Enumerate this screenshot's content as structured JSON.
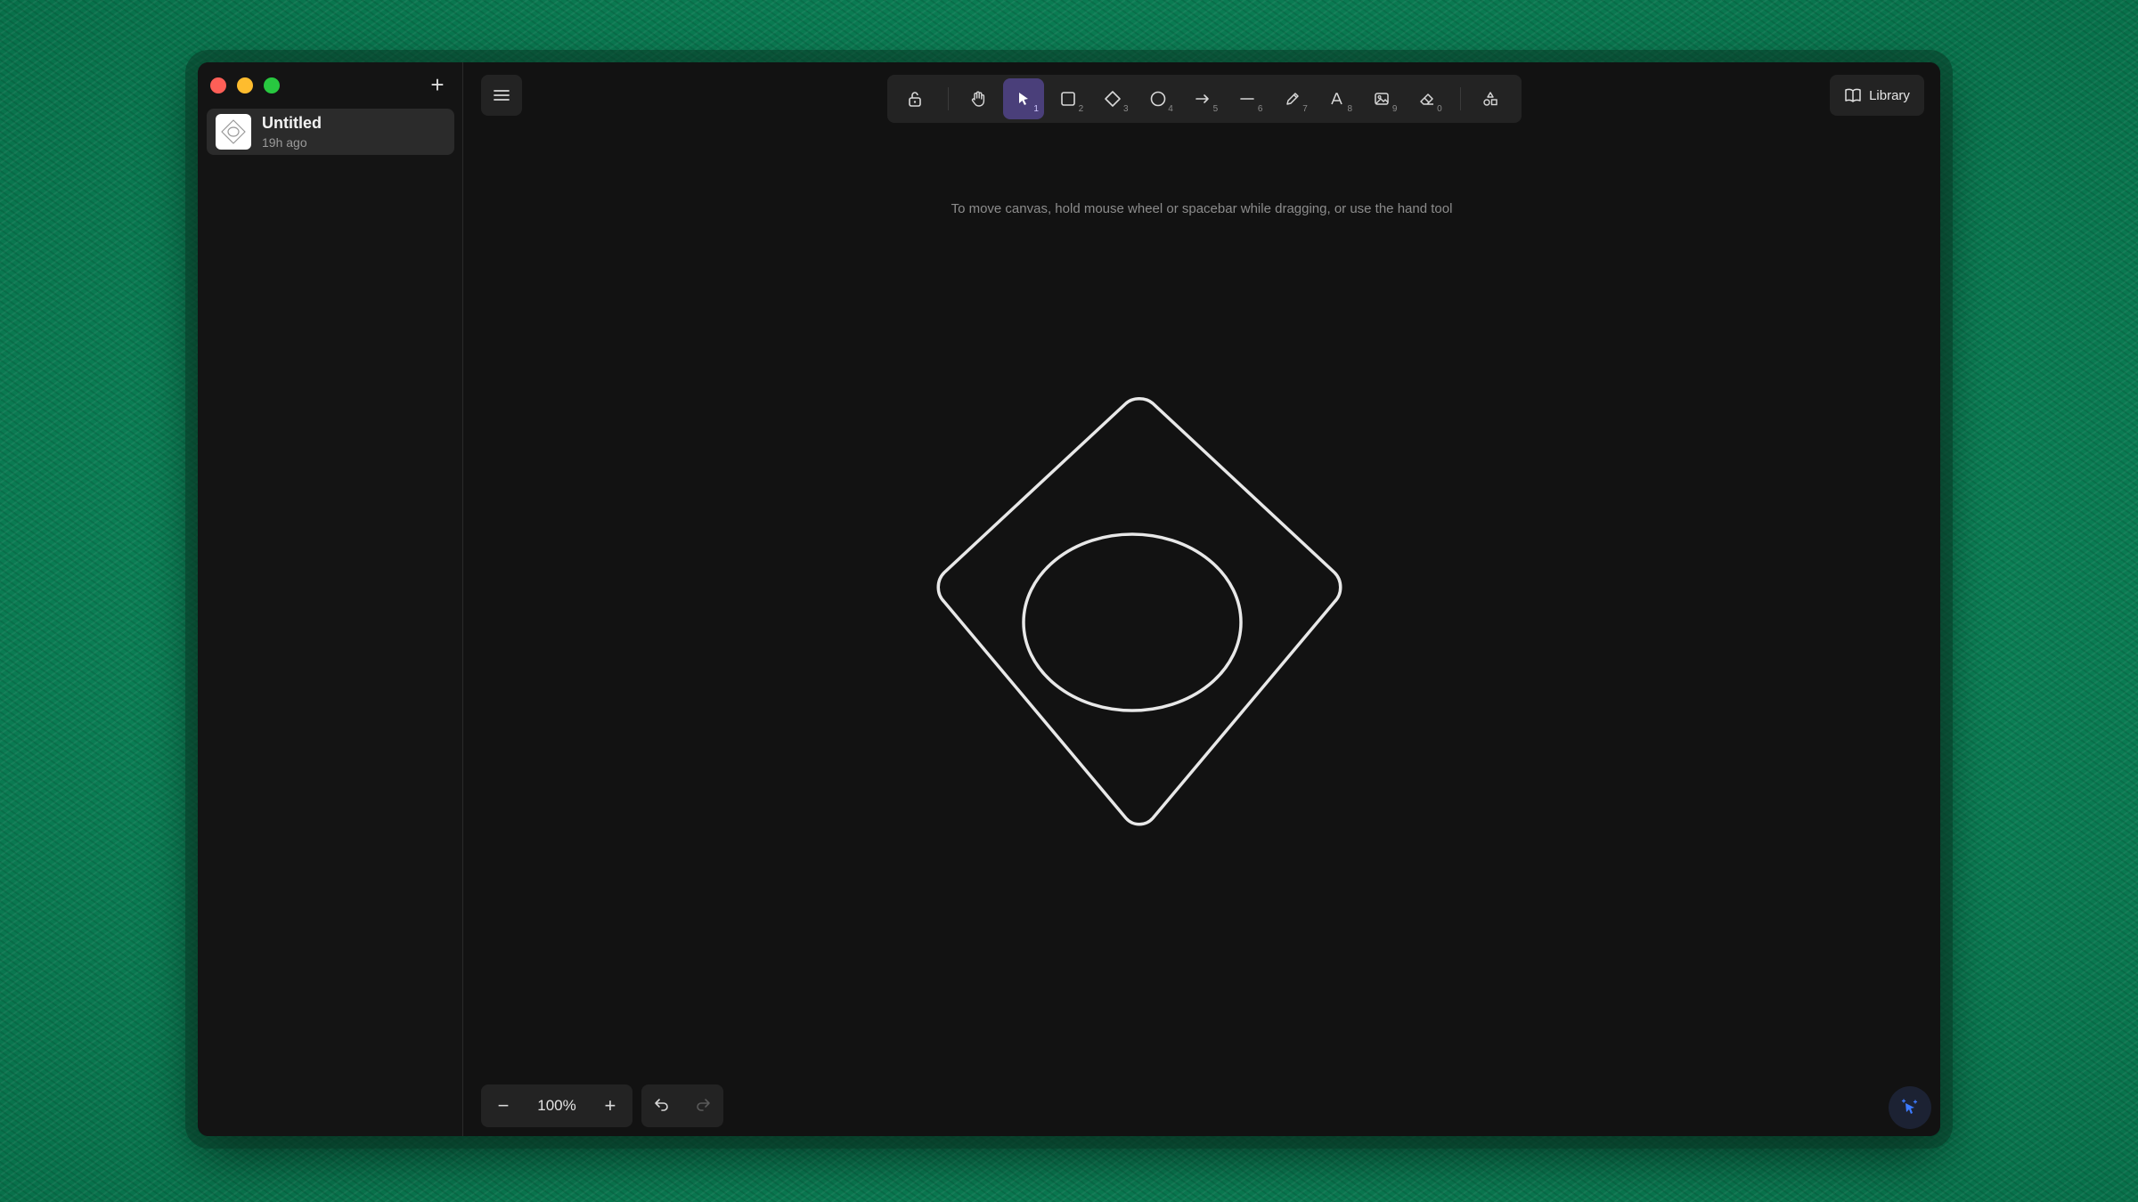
{
  "sidebar": {
    "new_button_label": "+",
    "files": [
      {
        "name": "Untitled",
        "time": "19h ago"
      }
    ]
  },
  "toolbar": {
    "tools": [
      {
        "name": "lock",
        "icon": "lock-icon",
        "key": ""
      },
      {
        "name": "hand",
        "icon": "hand-icon",
        "key": ""
      },
      {
        "name": "selection",
        "icon": "pointer-icon",
        "key": "1",
        "active": true
      },
      {
        "name": "rectangle",
        "icon": "rectangle-icon",
        "key": "2"
      },
      {
        "name": "diamond",
        "icon": "diamond-icon",
        "key": "3"
      },
      {
        "name": "ellipse",
        "icon": "ellipse-icon",
        "key": "4"
      },
      {
        "name": "arrow",
        "icon": "arrow-icon",
        "key": "5"
      },
      {
        "name": "line",
        "icon": "line-icon",
        "key": "6"
      },
      {
        "name": "draw",
        "icon": "pencil-icon",
        "key": "7"
      },
      {
        "name": "text",
        "icon": "text-icon",
        "key": "8"
      },
      {
        "name": "image",
        "icon": "image-icon",
        "key": "9"
      },
      {
        "name": "eraser",
        "icon": "eraser-icon",
        "key": "0"
      },
      {
        "name": "shapes-library",
        "icon": "shapes-icon",
        "key": ""
      }
    ]
  },
  "hint": "To move canvas, hold mouse wheel or spacebar while dragging, or use the hand tool",
  "library_label": "Library",
  "zoom": {
    "value": "100%"
  },
  "colors": {
    "active_tool": "#4a3f7a",
    "canvas": "#121212",
    "stroke": "#e8e8e8",
    "desktop": "#0c8a5c"
  }
}
